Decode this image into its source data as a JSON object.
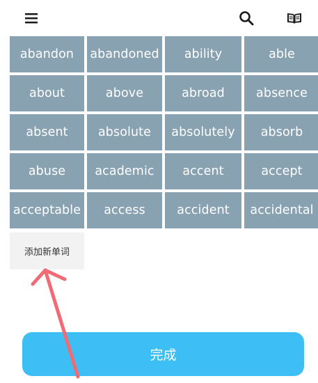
{
  "topbar": {
    "menu_icon": "menu-icon",
    "search_icon": "search-icon",
    "book_icon": "book-icon"
  },
  "words": [
    "abandon",
    "abandoned",
    "ability",
    "able",
    "about",
    "above",
    "abroad",
    "absence",
    "absent",
    "absolute",
    "absolutely",
    "absorb",
    "abuse",
    "academic",
    "accent",
    "accept",
    "acceptable",
    "access",
    "accident",
    "accidental"
  ],
  "add_word": {
    "label": "添加新单词"
  },
  "done": {
    "label": "完成"
  },
  "colors": {
    "cell_bg": "#88a2b2",
    "accent": "#3dbff6",
    "arrow": "#f06b73"
  }
}
